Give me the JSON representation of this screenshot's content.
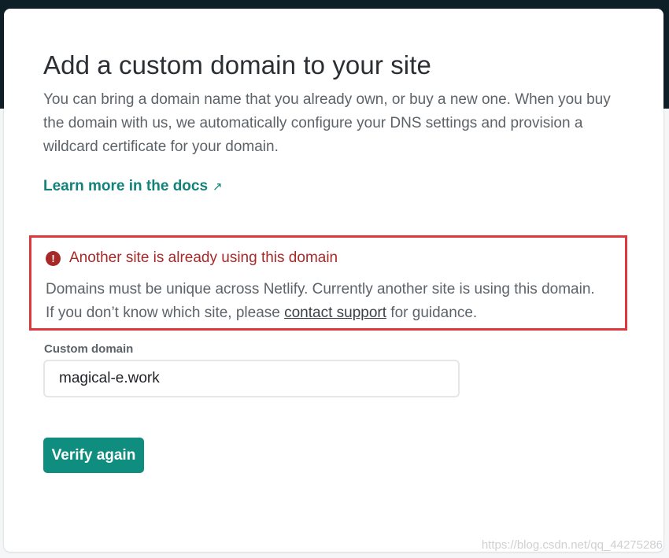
{
  "page": {
    "title": "Add a custom domain to your site",
    "description": "You can bring a domain name that you already own, or buy a new one. When you buy the domain with us, we automatically configure your DNS settings and provision a wildcard certificate for your domain.",
    "docs_link": {
      "label": "Learn more in the docs",
      "icon": "external-link-arrow-icon",
      "glyph": "↗"
    }
  },
  "error": {
    "icon": "exclamation-circle-icon",
    "icon_glyph": "!",
    "title": "Another site is already using this domain",
    "message_line1": "Domains must be unique across Netlify. Currently another site is using this domain.",
    "message_before_link": "If you don’t know which site, please ",
    "link_label": "contact support",
    "message_after_link": " for guidance.",
    "color": "#a82828",
    "border_color": "#e0363d"
  },
  "form": {
    "field_label": "Custom domain",
    "field_value": "magical-e.work",
    "submit_label": "Verify again"
  },
  "watermark": "https://blog.csdn.net/qq_44275286",
  "colors": {
    "header_background": "#0f1f28",
    "accent": "#0f8e7f",
    "link": "#11837a",
    "body_text": "#5c6369",
    "title_text": "#2b2f33"
  }
}
